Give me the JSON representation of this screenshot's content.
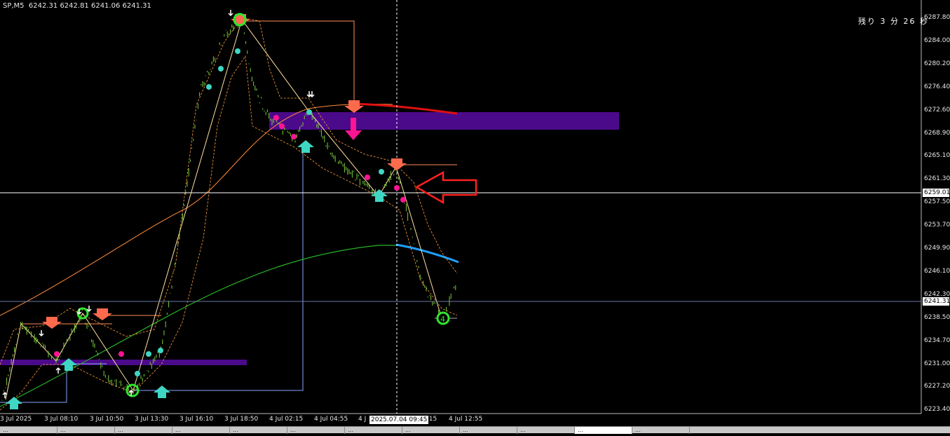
{
  "header": {
    "symbol": "SP,M5",
    "ohlc": "6242.31 6242.81 6241.06 6241.31"
  },
  "countdown": "残り 3 分 26 秒",
  "price_axis": {
    "labels": [
      "6287.80",
      "6284.00",
      "6280.20",
      "6276.40",
      "6272.60",
      "6268.90",
      "6265.10",
      "6261.30",
      "6257.50",
      "6253.70",
      "6249.90",
      "6246.10",
      "6242.30",
      "6238.50",
      "6234.70",
      "6231.00",
      "6227.20",
      "6223.40"
    ],
    "crosshair_price": "6259.01",
    "current_price": "6241.31"
  },
  "time_axis": {
    "labels": [
      "3 Jul 2025",
      "3 Jul 08:10",
      "3 Jul 10:50",
      "3 Jul 13:30",
      "3 Jul 16:10",
      "3 Jul 18:50",
      "4 Jul 02:15",
      "4 Jul 04:55",
      "4 J",
      "0:15",
      "4 Jul 12:55"
    ],
    "crosshair_time": "2025.07.04 09:45"
  },
  "zigzag_label": "4",
  "colors": {
    "background": "#000000",
    "candle": "#7ccd3a",
    "sell_arrow": "#ff6a4d",
    "buy_arrow": "#3fd6c4",
    "zone": "#4b0a8a",
    "ma_green": "#27b327",
    "ma_orange": "#ff8c3a",
    "ma_red": "#e01010",
    "ma_blue": "#1ea0ff",
    "big_arrow": "#ff1493",
    "outline_arrow": "#ff2020"
  },
  "tabs": [
    "...",
    "...",
    "...",
    "...",
    "...",
    "...",
    "...",
    "...",
    "...",
    "...",
    "...",
    "..."
  ]
}
